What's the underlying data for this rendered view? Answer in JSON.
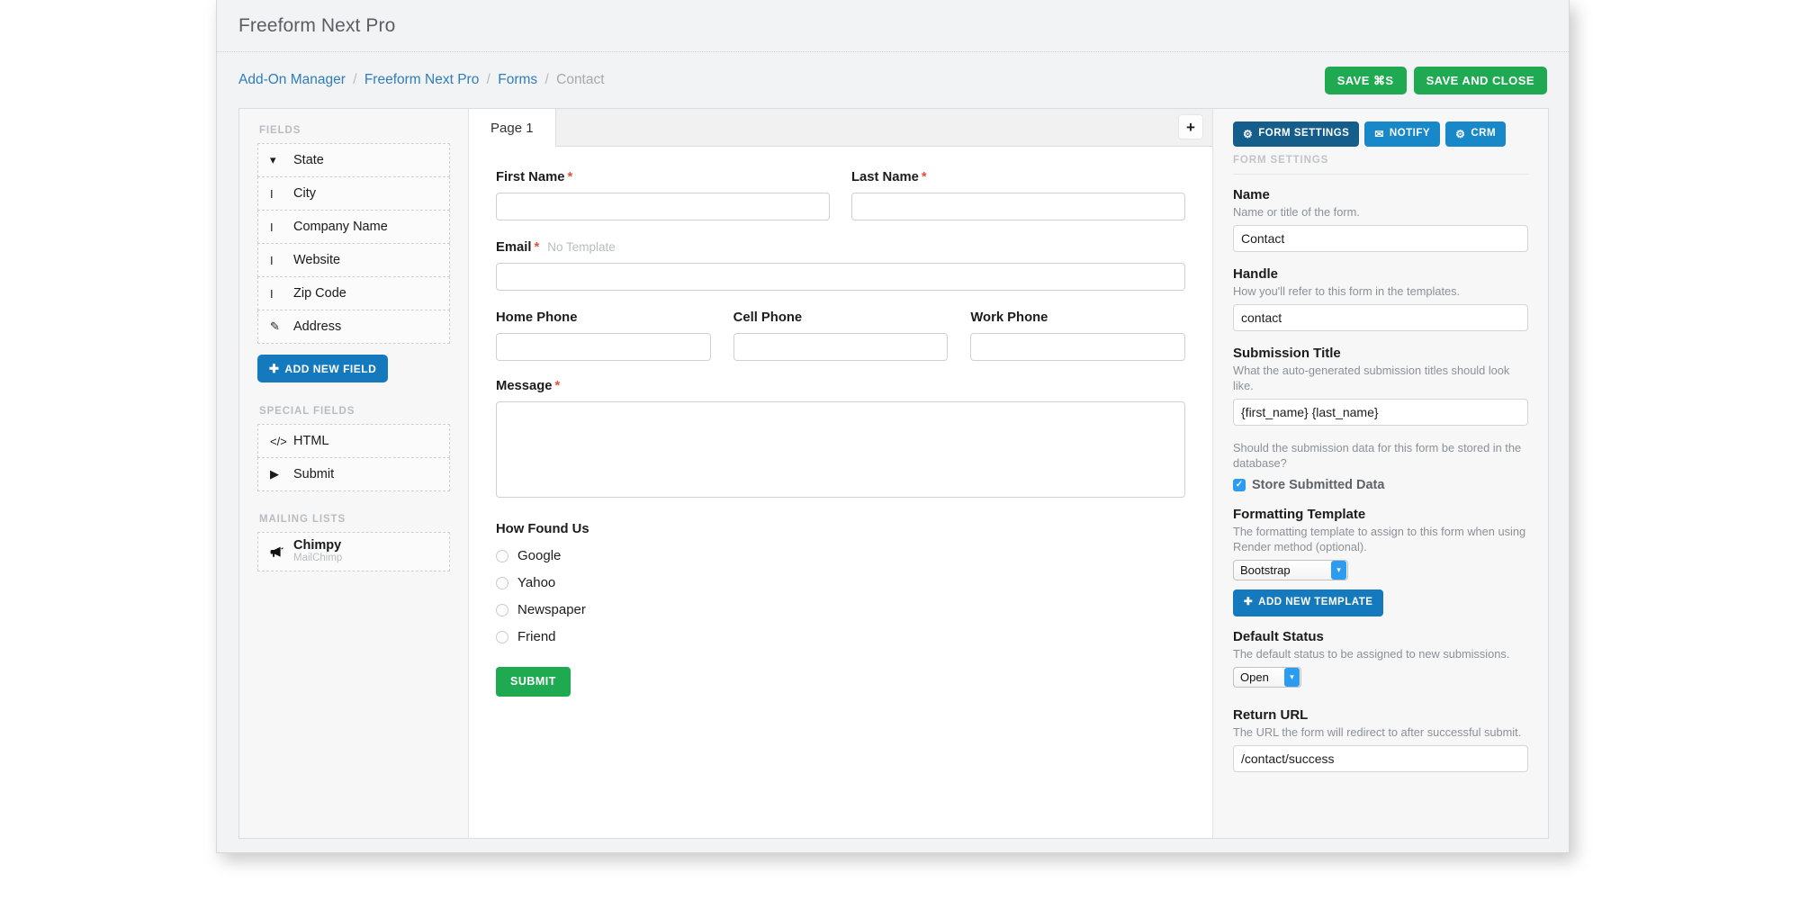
{
  "window": {
    "title": "Freeform Next Pro"
  },
  "breadcrumb": {
    "items": [
      {
        "label": "Add-On Manager",
        "link": true
      },
      {
        "label": "Freeform Next Pro",
        "link": true
      },
      {
        "label": "Forms",
        "link": true
      },
      {
        "label": "Contact",
        "link": false
      }
    ],
    "separator": "/"
  },
  "header_actions": {
    "save_label": "SAVE ⌘S",
    "save_close_label": "SAVE AND CLOSE",
    "green": "#1faa52"
  },
  "sidebar": {
    "fields_heading": "FIELDS",
    "fields": [
      {
        "label": "State",
        "icon": "chevron-down-icon",
        "glyph": "▾"
      },
      {
        "label": "City",
        "icon": "text-cursor-icon",
        "glyph": "I"
      },
      {
        "label": "Company Name",
        "icon": "text-cursor-icon",
        "glyph": "I"
      },
      {
        "label": "Website",
        "icon": "text-cursor-icon",
        "glyph": "I"
      },
      {
        "label": "Zip Code",
        "icon": "text-cursor-icon",
        "glyph": "I"
      },
      {
        "label": "Address",
        "icon": "pencil-square-icon",
        "glyph": "✎"
      }
    ],
    "add_field_label": "ADD NEW FIELD",
    "special_heading": "SPECIAL FIELDS",
    "special_fields": [
      {
        "label": "HTML",
        "icon": "code-icon",
        "glyph": "</>"
      },
      {
        "label": "Submit",
        "icon": "play-triangle-icon",
        "glyph": "▶"
      }
    ],
    "mailing_heading": "MAILING LISTS",
    "mailing_lists": [
      {
        "label": "Chimpy",
        "sub": "MailChimp",
        "icon": "megaphone-icon",
        "glyph": "📢"
      }
    ]
  },
  "center": {
    "tabs": [
      {
        "label": "Page 1",
        "active": true
      }
    ],
    "add_tab_label": "+",
    "fields": {
      "first_name": {
        "label": "First Name",
        "required": true,
        "value": ""
      },
      "last_name": {
        "label": "Last Name",
        "required": true,
        "value": ""
      },
      "email": {
        "label": "Email",
        "required": true,
        "note": "No Template",
        "value": ""
      },
      "home_phone": {
        "label": "Home Phone",
        "required": false,
        "value": ""
      },
      "cell_phone": {
        "label": "Cell Phone",
        "required": false,
        "value": ""
      },
      "work_phone": {
        "label": "Work Phone",
        "required": false,
        "value": ""
      },
      "message": {
        "label": "Message",
        "required": true,
        "value": ""
      },
      "how_found_us": {
        "label": "How Found Us",
        "options": [
          "Google",
          "Yahoo",
          "Newspaper",
          "Friend"
        ],
        "selected": null
      }
    },
    "submit_label": "SUBMIT",
    "required_marker": "*"
  },
  "settings_panel": {
    "tabs": [
      {
        "label": "FORM SETTINGS",
        "icon": "gear-icon",
        "glyph": "⚙",
        "active": true
      },
      {
        "label": "NOTIFY",
        "icon": "envelope-icon",
        "glyph": "✉",
        "active": false
      },
      {
        "label": "CRM",
        "icon": "gear-icon",
        "glyph": "⚙",
        "active": false
      }
    ],
    "section_title": "FORM SETTINGS",
    "name": {
      "label": "Name",
      "desc": "Name or title of the form.",
      "value": "Contact"
    },
    "handle": {
      "label": "Handle",
      "desc": "How you'll refer to this form in the templates.",
      "value": "contact"
    },
    "submission_title": {
      "label": "Submission Title",
      "desc": "What the auto-generated submission titles should look like.",
      "value": "{first_name} {last_name}"
    },
    "store_data": {
      "desc": "Should the submission data for this form be stored in the database?",
      "label": "Store Submitted Data",
      "checked": true,
      "check_glyph": "✓"
    },
    "formatting_template": {
      "label": "Formatting Template",
      "desc": "The formatting template to assign to this form when using Render method (optional).",
      "value": "Bootstrap",
      "add_label": "ADD NEW TEMPLATE"
    },
    "default_status": {
      "label": "Default Status",
      "desc": "The default status to be assigned to new submissions.",
      "value": "Open"
    },
    "return_url": {
      "label": "Return URL",
      "desc": "The URL the form will redirect to after successful submit.",
      "value": "/contact/success"
    },
    "accent_blue": "#1888c9",
    "accent_blue_dark": "#155e8c"
  }
}
